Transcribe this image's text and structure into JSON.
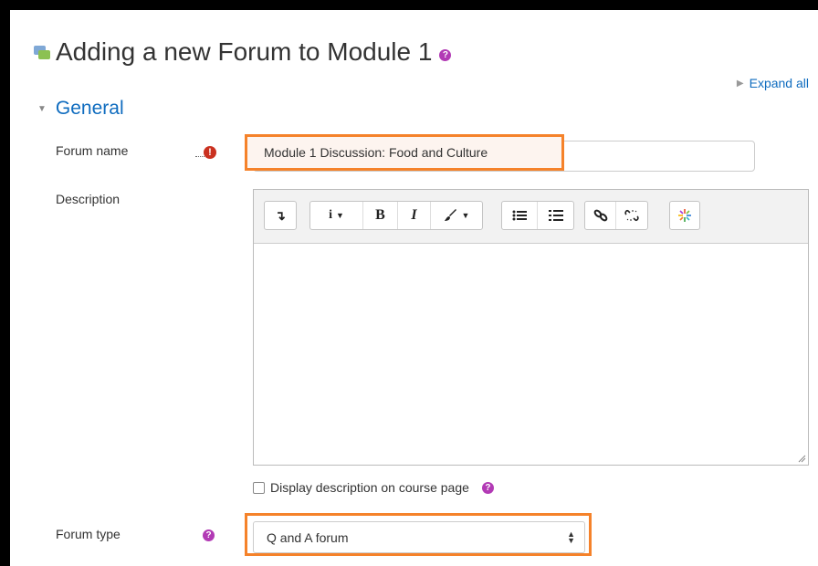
{
  "page": {
    "title": "Adding a new Forum to Module 1",
    "expand_all": "Expand all"
  },
  "section": {
    "title": "General"
  },
  "form": {
    "forum_name": {
      "label": "Forum name",
      "value": "Module 1 Discussion: Food and Culture",
      "required_icon": "exclamation-icon"
    },
    "description": {
      "label": "Description",
      "toolbar": {
        "groups": [
          [
            {
              "name": "collapse-toolbar-icon",
              "glyph": "↴"
            }
          ],
          [
            {
              "name": "info-icon",
              "glyph": "i",
              "dropdown": true
            },
            {
              "name": "bold-icon",
              "glyph": "B"
            },
            {
              "name": "italic-icon",
              "glyph": "I"
            },
            {
              "name": "brush-icon",
              "glyph": "🖌",
              "dropdown": true
            }
          ],
          [
            {
              "name": "unordered-list-icon",
              "glyph": "☰"
            },
            {
              "name": "ordered-list-icon",
              "glyph": "☷"
            }
          ],
          [
            {
              "name": "link-icon",
              "glyph": "🔗"
            },
            {
              "name": "unlink-icon",
              "glyph": "⛓"
            }
          ],
          [
            {
              "name": "media-icon",
              "glyph": "✳"
            }
          ]
        ]
      },
      "content": ""
    },
    "display_description": {
      "label": "Display description on course page",
      "checked": false
    },
    "forum_type": {
      "label": "Forum type",
      "value": "Q and A forum"
    }
  },
  "colors": {
    "link": "#0f6cbf",
    "help": "#b23ab5",
    "required": "#ca3120",
    "highlight": "#f5822a"
  }
}
